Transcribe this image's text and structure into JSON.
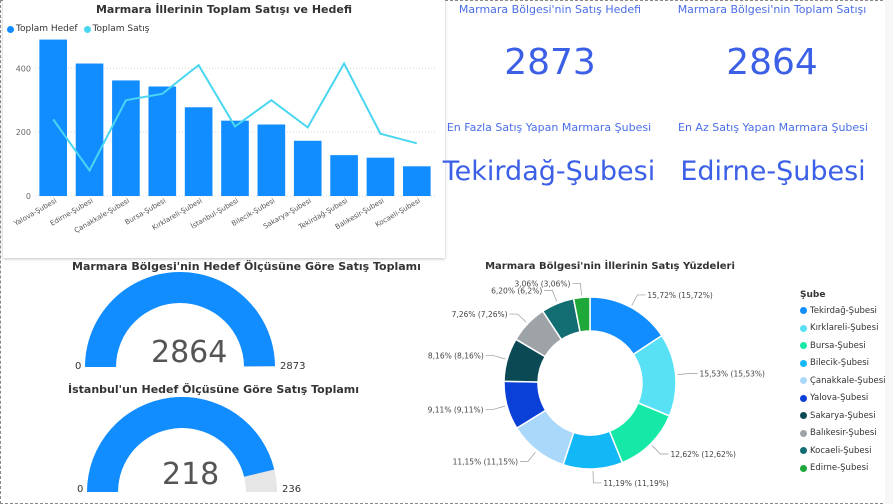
{
  "bar_chart": {
    "title": "Marmara İllerinin Toplam Satışı ve Hedefi",
    "legend": [
      {
        "label": "Toplam Hedef",
        "color": "#118dff"
      },
      {
        "label": "Toplam Satış",
        "color": "#4ad6f0"
      }
    ]
  },
  "chart_data": [
    {
      "type": "bar",
      "title": "Marmara İllerinin Toplam Satışı ve Hedefi",
      "categories": [
        "Yalova-Şubesi",
        "Edirne-Şubesi",
        "Çanakkale-Şubesi",
        "Bursa-Şubesi",
        "Kırklareli-Şubesi",
        "İstanbul-Şubesi",
        "Bilecik-Şubesi",
        "Sakarya-Şubesi",
        "Tekirdağ-Şubesi",
        "Balıkesir-Şubesi",
        "Kocaeli-Şubesi"
      ],
      "series": [
        {
          "name": "Toplam Hedef",
          "type": "bar",
          "color": "#118dff",
          "values": [
            490,
            415,
            362,
            343,
            278,
            236,
            224,
            173,
            128,
            120,
            93
          ]
        },
        {
          "name": "Toplam Satış",
          "type": "line",
          "color": "#4ad6f0",
          "values": [
            240,
            80,
            300,
            320,
            410,
            218,
            300,
            215,
            415,
            195,
            165
          ]
        }
      ],
      "y_ticks": [
        "0",
        "200",
        "400"
      ],
      "ylim": [
        0,
        520
      ],
      "grid": true,
      "legend_position": "top-left"
    },
    {
      "type": "pie",
      "title": "Marmara Bölgesi'nin İllerinin Satış Yüzdeleri",
      "legend_title": "Şube",
      "slices": [
        {
          "name": "Tekirdağ-Şubesi",
          "value": 15.72,
          "label": "15,72% (15,72%)",
          "color": "#118dff"
        },
        {
          "name": "Kırklareli-Şubesi",
          "value": 15.53,
          "label": "15,53% (15,53%)",
          "color": "#58e0f5"
        },
        {
          "name": "Bursa-Şubesi",
          "value": 12.62,
          "label": "12,62% (12,62%)",
          "color": "#16e8a8"
        },
        {
          "name": "Bilecik-Şubesi",
          "value": 11.19,
          "label": "11,19% (11,19%)",
          "color": "#12b7f5"
        },
        {
          "name": "Çanakkale-Şubesi",
          "value": 11.15,
          "label": "11,15% (11,15%)",
          "color": "#a9d8fa"
        },
        {
          "name": "Yalova-Şubesi",
          "value": 9.11,
          "label": "9,11% (9,11%)",
          "color": "#0a3fd8"
        },
        {
          "name": "Sakarya-Şubesi",
          "value": 8.16,
          "label": "8,16% (8,16%)",
          "color": "#0b4a55"
        },
        {
          "name": "Balıkesir-Şubesi",
          "value": 7.26,
          "label": "7,26% (7,26%)",
          "color": "#9ea3a8"
        },
        {
          "name": "Kocaeli-Şubesi",
          "value": 6.2,
          "label": "6,20% (6,2%)",
          "color": "#136e73"
        },
        {
          "name": "Edirne-Şubesi",
          "value": 3.06,
          "label": "3,06% (3,06%)",
          "color": "#1ea83a"
        }
      ]
    }
  ],
  "cards": {
    "target_title": "Marmara Bölgesi'nin Satış Hedefi",
    "target_value": "2873",
    "sales_title": "Marmara Bölgesi'nin Toplam Satışı",
    "sales_value": "2864",
    "max_title": "En Fazla Satış Yapan Marmara Şubesi",
    "max_value": "Tekirdağ-Şubesi",
    "min_title": "En Az Satış Yapan Marmara Şubesi",
    "min_value": "Edirne-Şubesi"
  },
  "gauge1": {
    "title": "Marmara Bölgesi'nin Hedef Ölçüsüne Göre Satış Toplamı",
    "value": 2864,
    "value_label": "2864",
    "min": "0",
    "max": "2873",
    "max_value": 2873,
    "fill_color": "#118dff",
    "track_color": "#e6e6e6"
  },
  "gauge2": {
    "title": "İstanbul'un Hedef Ölçüsüne Göre Satış Toplamı",
    "value": 218,
    "value_label": "218",
    "min": "0",
    "max": "236",
    "max_value": 236,
    "fill_color": "#118dff",
    "track_color": "#e6e6e6"
  }
}
